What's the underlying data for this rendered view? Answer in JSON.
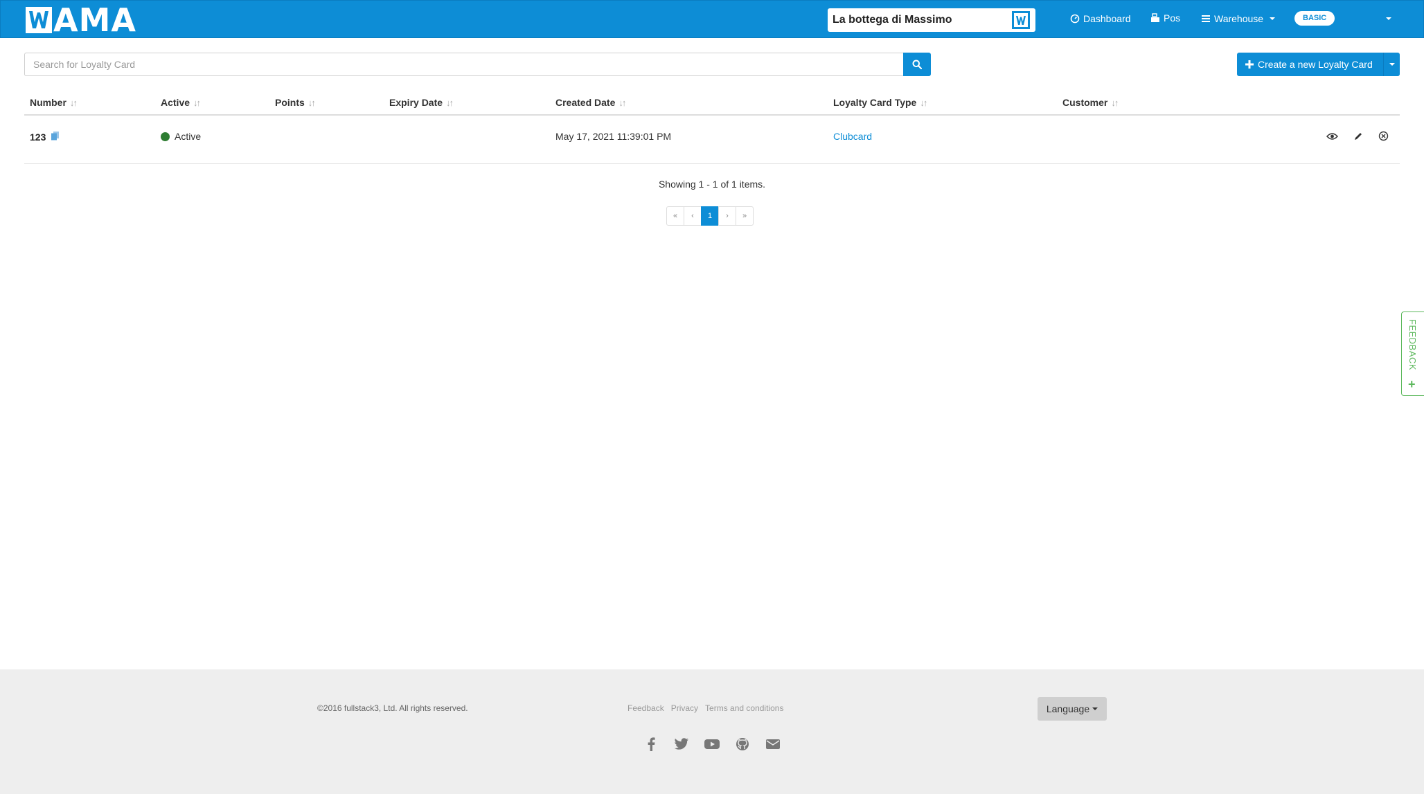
{
  "brand": {
    "logo_text": "AMA",
    "logo_icon": "wama-w-logo"
  },
  "store": {
    "name": "La bottega di Massimo"
  },
  "nav": {
    "dashboard": "Dashboard",
    "pos": "Pos",
    "warehouse": "Warehouse",
    "plan_badge": "BASIC"
  },
  "search": {
    "placeholder": "Search for Loyalty Card"
  },
  "create_button": {
    "label": "Create a new Loyalty Card"
  },
  "table": {
    "headers": {
      "number": "Number",
      "active": "Active",
      "points": "Points",
      "expiry": "Expiry Date",
      "created": "Created Date",
      "type": "Loyalty Card Type",
      "customer": "Customer"
    },
    "rows": [
      {
        "number": "123",
        "active": "Active",
        "points": "",
        "expiry": "",
        "created": "May 17, 2021 11:39:01 PM",
        "type": "Clubcard",
        "customer": ""
      }
    ]
  },
  "summary": "Showing 1 - 1 of 1 items.",
  "pagination": {
    "first": "«",
    "prev": "‹",
    "current": "1",
    "next": "›",
    "last": "»"
  },
  "feedback_tab": {
    "label": "FEEDBACK",
    "plus": "+"
  },
  "footer": {
    "copyright": "©2016 fullstack3, Ltd. All rights reserved.",
    "links": [
      "Feedback",
      "Privacy",
      "Terms and conditions"
    ],
    "language": "Language",
    "social": [
      "facebook-icon",
      "twitter-icon",
      "youtube-icon",
      "github-icon",
      "email-icon"
    ]
  },
  "colors": {
    "primary": "#0d8dd6",
    "active_dot": "#2e7d32",
    "feedback": "#5cb85c",
    "footer_bg": "#eeeeee"
  }
}
